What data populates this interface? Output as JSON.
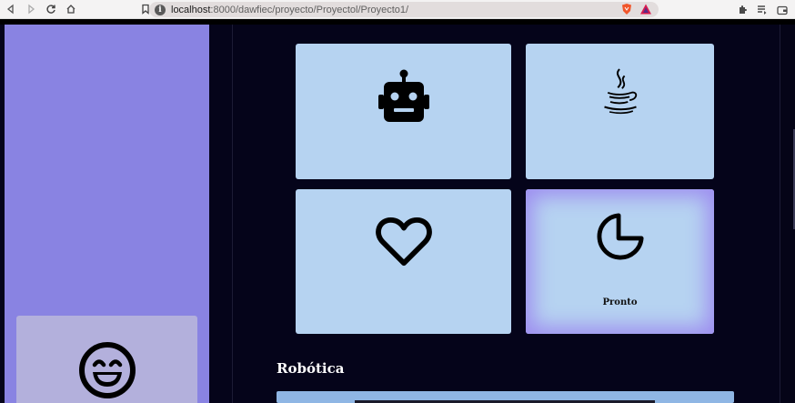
{
  "browser": {
    "url_host": "localhost",
    "url_path": ":8000/dawfiec/proyecto/Proyectol/Proyecto1/"
  },
  "tiles": [
    {
      "name": "robot",
      "label": ""
    },
    {
      "name": "java",
      "label": ""
    },
    {
      "name": "heart",
      "label": ""
    },
    {
      "name": "pie",
      "label": "Pronto"
    }
  ],
  "section": {
    "title": "Robótica"
  }
}
